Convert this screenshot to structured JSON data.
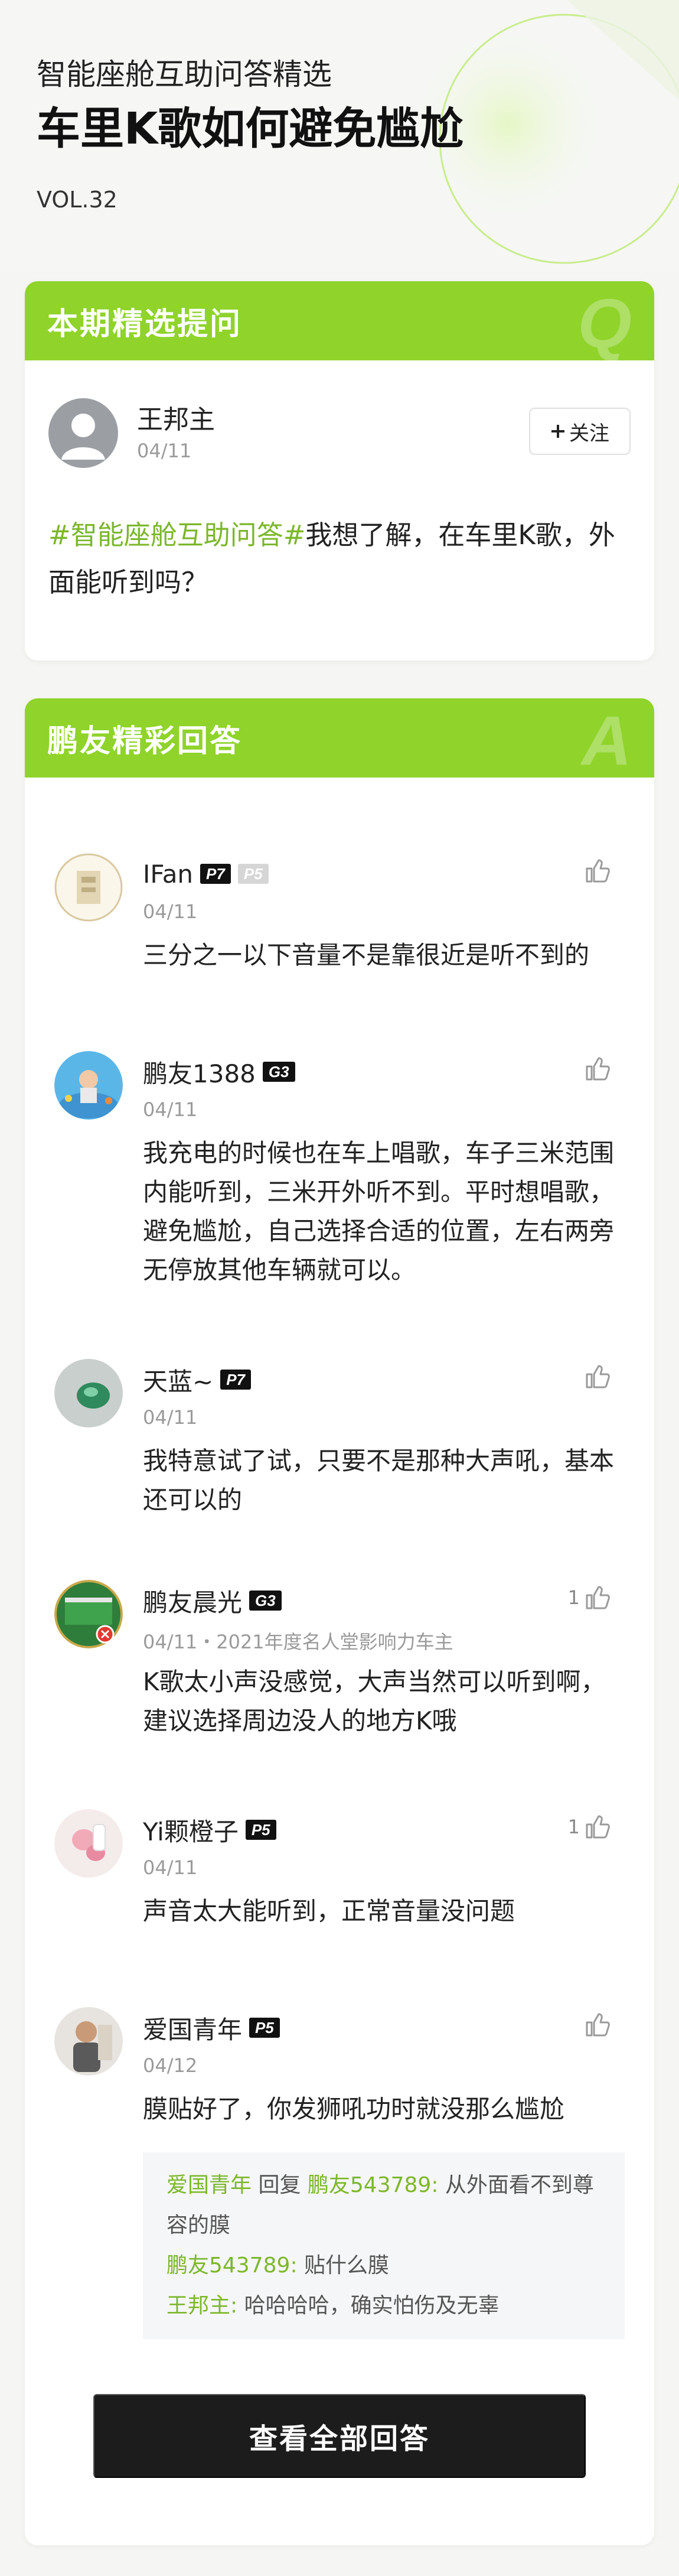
{
  "header": {
    "kicker": "智能座舱互助问答精选",
    "title": "车里K歌如何避免尴尬",
    "vol": "VOL.32"
  },
  "colors": {
    "accent": "#8fd32b",
    "tag": "#7cb72a",
    "button": "#1c1c1c"
  },
  "question_card": {
    "title": "本期精选提问",
    "letter": "Q",
    "user": {
      "name": "王邦主",
      "date": "04/11"
    },
    "follow_label": "关注",
    "follow_icon": "plus-icon",
    "tag": "#智能座舱互助问答#",
    "text": "我想了解，在车里K歌，外面能听到吗？"
  },
  "answer_card": {
    "title": "鹏友精彩回答",
    "letter": "A",
    "answers": [
      {
        "name": "IFan",
        "badges": [
          "P7",
          "P5"
        ],
        "date": "04/11",
        "likes": "",
        "text": "三分之一以下音量不是靠很近是听不到的"
      },
      {
        "name": "鹏友1388",
        "badges": [
          "G3"
        ],
        "date": "04/11",
        "likes": "",
        "text": "我充电的时候也在车上唱歌，车子三米范围内能听到，三米开外听不到。平时想唱歌，避免尴尬，自己选择合适的位置，左右两旁无停放其他车辆就可以。"
      },
      {
        "name": "天蓝~",
        "badges": [
          "P7"
        ],
        "date": "04/11",
        "likes": "",
        "text": "我特意试了试，只要不是那种大声吼，基本还可以的"
      },
      {
        "name": "鹏友晨光",
        "badges": [
          "G3"
        ],
        "date": "04/11・2021年度名人堂影响力车主",
        "likes": "1",
        "text": "K歌太小声没感觉，大声当然可以听到啊，建议选择周边没人的地方K哦"
      },
      {
        "name": "Yi颗橙子",
        "badges": [
          "P5"
        ],
        "date": "04/11",
        "likes": "1",
        "text": "声音太大能听到，正常音量没问题"
      },
      {
        "name": "爱国青年",
        "badges": [
          "P5"
        ],
        "date": "04/12",
        "likes": "",
        "text": "膜贴好了，你发狮吼功时就没那么尴尬"
      }
    ],
    "replies": [
      {
        "from": "爱国青年",
        "verb": " 回复 ",
        "to": "鹏友543789",
        "text": "从外面看不到尊容的膜"
      },
      {
        "from": "鹏友543789",
        "verb": "",
        "to": "",
        "text": "贴什么膜"
      },
      {
        "from": "王邦主",
        "verb": "",
        "to": "",
        "text": "哈哈哈哈，确实怕伤及无辜"
      }
    ],
    "view_all_label": "查看全部回答"
  }
}
